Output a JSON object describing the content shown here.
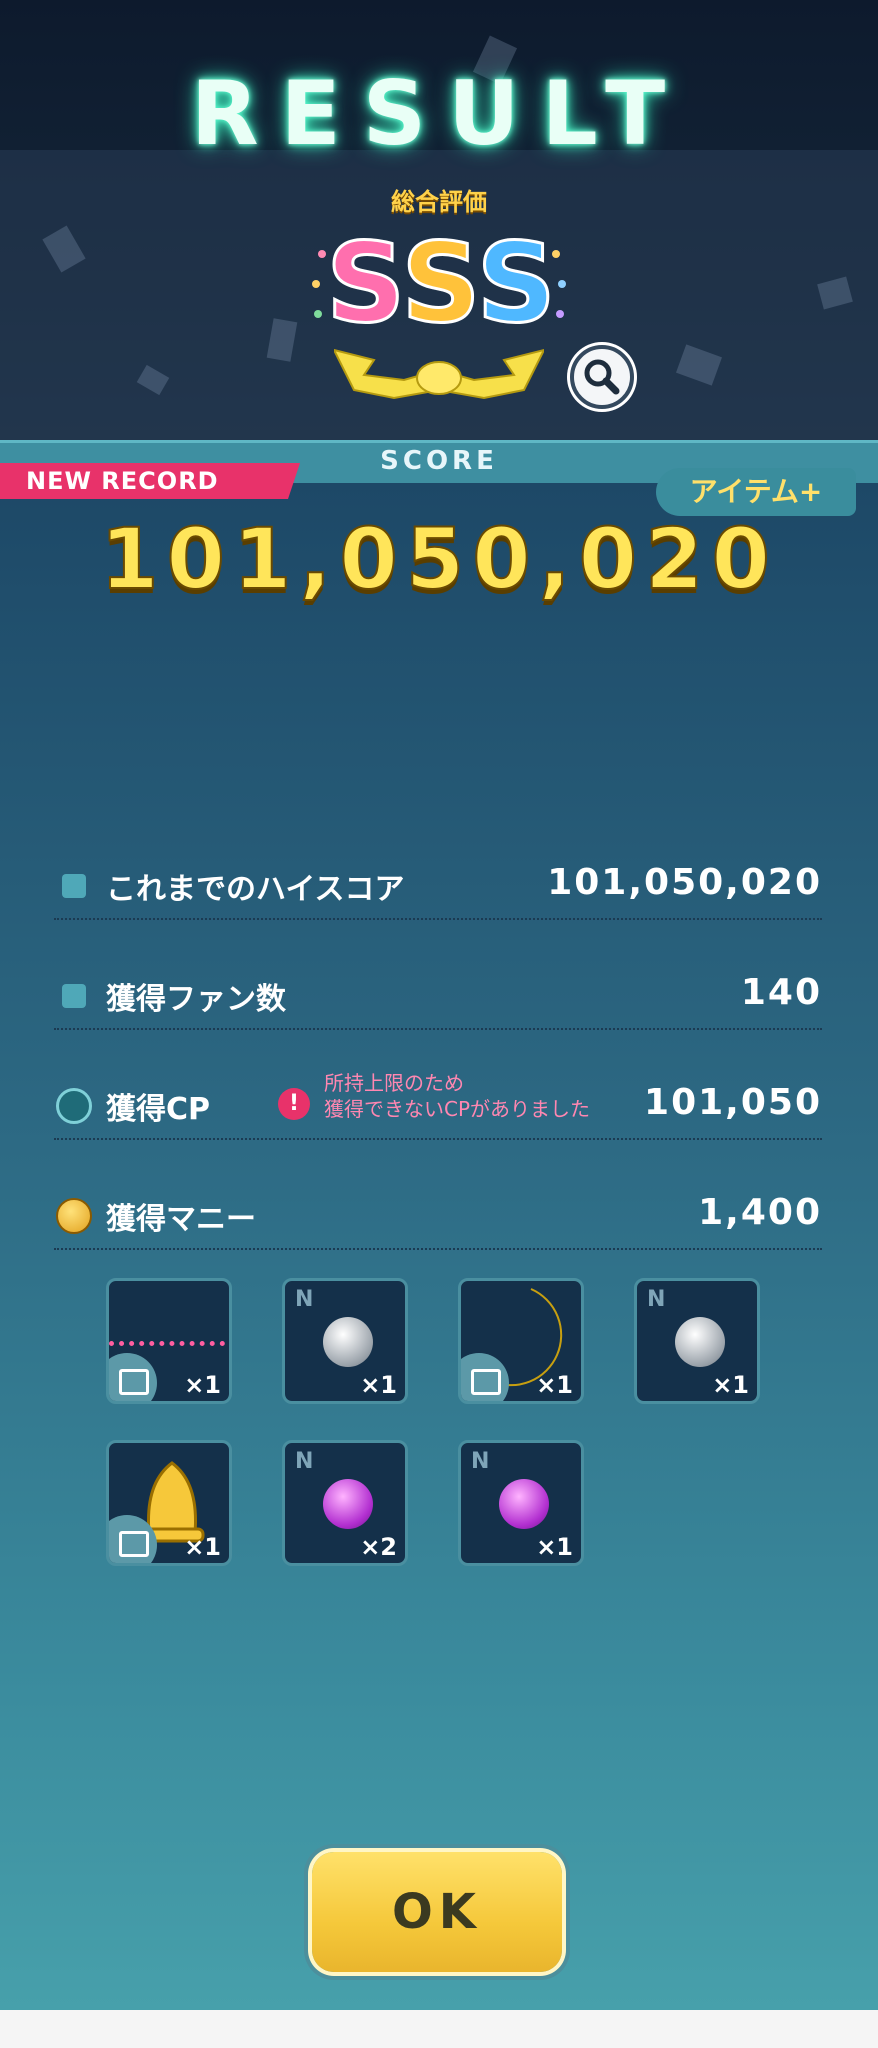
{
  "header": {
    "title": "RESULT",
    "overall_label": "総合評価",
    "rank": "SSS"
  },
  "score_section": {
    "tab_label": "SCORE",
    "new_record_label": "NEW RECORD",
    "item_plus_label": "アイテム+",
    "score": "101,050,020"
  },
  "stats": {
    "high_score_label": "これまでのハイスコア",
    "high_score_value": "101,050,020",
    "fans_label": "獲得ファン数",
    "fans_value": "140",
    "cp_label": "獲得CP",
    "cp_warning_line1": "所持上限のため",
    "cp_warning_line2": "獲得できないCPがありました",
    "cp_warning_icon": "!",
    "cp_value": "101,050",
    "money_label": "獲得マニー",
    "money_value": "1,400"
  },
  "rewards": [
    {
      "qty": "×1",
      "rarity": "",
      "icon": "pink-dot-line-icon"
    },
    {
      "qty": "×1",
      "rarity": "N",
      "icon": "silver-orb-icon"
    },
    {
      "qty": "×1",
      "rarity": "",
      "icon": "crescent-moon-icon"
    },
    {
      "qty": "×1",
      "rarity": "N",
      "icon": "silver-orb-icon"
    },
    {
      "qty": "×1",
      "rarity": "",
      "icon": "bell-icon"
    },
    {
      "qty": "×2",
      "rarity": "N",
      "icon": "purple-orb-icon"
    },
    {
      "qty": "×1",
      "rarity": "N",
      "icon": "purple-orb-icon"
    }
  ],
  "ok_label": "OK",
  "colors": {
    "accent_yellow": "#ffe55a",
    "new_record_pink": "#e8326a",
    "panel_teal": "#3b8c9e"
  }
}
